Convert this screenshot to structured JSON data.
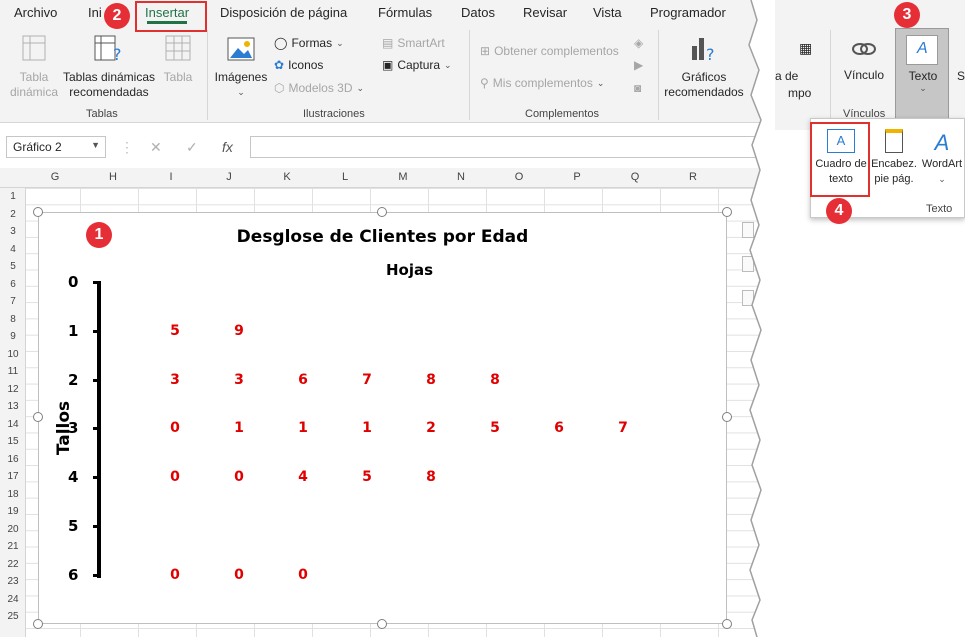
{
  "ribbon_tabs": [
    "Archivo",
    "Ini",
    "Insertar",
    "Disposición de página",
    "Fórmulas",
    "Datos",
    "Revisar",
    "Vista",
    "Programador"
  ],
  "active_tab": "Insertar",
  "groups": {
    "tablas": {
      "label": "Tablas",
      "items": [
        {
          "label": "Tabla dinámica",
          "enabled": false
        },
        {
          "label": "Tablas dinámicas recomendadas",
          "enabled": true
        },
        {
          "label": "Tabla",
          "enabled": false
        }
      ]
    },
    "ilustraciones": {
      "label": "Ilustraciones",
      "imagenes": "Imágenes",
      "formas": "Formas",
      "iconos": "Iconos",
      "modelos": "Modelos 3D",
      "smartart": "SmartArt",
      "captura": "Captura"
    },
    "complementos": {
      "label": "Complementos",
      "obtener": "Obtener complementos",
      "mis": "Mis complementos"
    },
    "graficos": {
      "label": "Gráficos recomendados"
    }
  },
  "right_panel": {
    "partial_a": "a de",
    "partial_b": "mpo",
    "vinculo": "Vínculo",
    "texto": "Texto",
    "vinculos_group": "Vínculos",
    "partial_s": "S"
  },
  "texto_dropdown": {
    "cuadro": "Cuadro de texto",
    "encabez": "Encabez. pie pág.",
    "wordart": "WordArt",
    "group": "Texto"
  },
  "formula_bar": {
    "name_box": "Gráfico 2",
    "fx": "fx"
  },
  "columns": [
    "G",
    "H",
    "I",
    "J",
    "K",
    "L",
    "M",
    "N",
    "O",
    "P",
    "Q",
    "R"
  ],
  "rows": [
    "1",
    "2",
    "3",
    "4",
    "5",
    "6",
    "7",
    "8",
    "9",
    "10",
    "11",
    "12",
    "13",
    "14",
    "15",
    "16",
    "17",
    "18",
    "19",
    "20",
    "21",
    "22",
    "23",
    "24",
    "25"
  ],
  "chart_data": {
    "type": "table",
    "title": "Desglose de Clientes por Edad",
    "leaves_label": "Hojas",
    "stems_label": "Tallos",
    "stems": [
      "0",
      "1",
      "2",
      "3",
      "4",
      "5",
      "6"
    ],
    "leaves": [
      [],
      [
        "5",
        "9"
      ],
      [
        "3",
        "3",
        "6",
        "7",
        "8",
        "8"
      ],
      [
        "0",
        "1",
        "1",
        "1",
        "2",
        "5",
        "6",
        "7"
      ],
      [
        "0",
        "0",
        "4",
        "5",
        "8"
      ],
      [],
      [
        "0",
        "0",
        "0"
      ]
    ]
  },
  "badges": [
    "1",
    "2",
    "3",
    "4"
  ],
  "colors": {
    "accent": "#217346",
    "leaf": "#e00000",
    "badge": "#e62e36"
  }
}
